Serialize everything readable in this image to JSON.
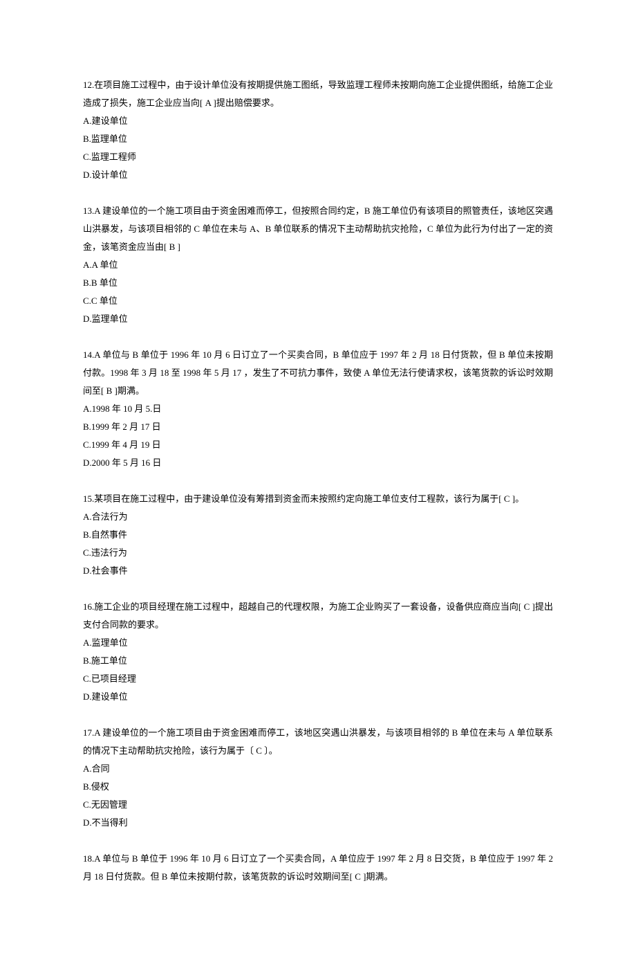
{
  "questions": [
    {
      "number": "12",
      "text": "12.在项目施工过程中，由于设计单位没有按期提供施工图纸，导致监理工程师未按期向施工企业提供图纸，给施工企业造成了损失，施工企业应当向[ A ]提出赔偿要求。",
      "options": [
        "A.建设单位",
        "B.监理单位",
        "C.监理工程师",
        "D.设计单位"
      ]
    },
    {
      "number": "13",
      "text": "13.A 建设单位的一个施工项目由于资金困难而停工，但按照合同约定，B 施工单位仍有该项目的照管责任，该地区突遇山洪暴发，与该项目相邻的 C 单位在未与 A、B 单位联系的情况下主动帮助抗灾抢险，C 单位为此行为付出了一定的资金，该笔资金应当由[ B ]",
      "options": [
        "A.A 单位",
        "B.B 单位",
        "C.C 单位",
        "D.监理单位"
      ]
    },
    {
      "number": "14",
      "text": "14.A 单位与 B 单位于 1996 年 10 月 6 日订立了一个买卖合同，B 单位应于 1997 年 2 月 18 日付货款，但 B 单位未按期付款。1998 年 3 月 18 至 1998 年 5 月 17 ，发生了不可抗力事件，致使 A 单位无法行使请求权，该笔货款的诉讼时效期间至[ B ]期满。",
      "options": [
        "A.1998 年 10 月 5.日",
        "B.1999 年 2 月 17 日",
        "C.1999 年 4 月 19 日",
        "D.2000 年 5 月 16 日"
      ]
    },
    {
      "number": "15",
      "text": "15.某项目在施工过程中，由于建设单位没有筹措到资金而未按照约定向施工单位支付工程款，该行为属于[ C ]。",
      "options": [
        "A.合法行为",
        "B.自然事件",
        "C.违法行为",
        "D.社会事件"
      ]
    },
    {
      "number": "16",
      "text": "16.施工企业的项目经理在施工过程中，超越自己的代理权限，为施工企业购买了一套设备，设备供应商应当向[ C ]提出支付合同款的要求。",
      "options": [
        "A.监理单位",
        "B.施工单位",
        "C.已项目经理",
        "D.建设单位"
      ]
    },
    {
      "number": "17",
      "text": "17.A 建设单位的一个施工项目由于资金困难而停工，该地区突遇山洪暴发，与该项目相邻的 B 单位在未与 A 单位联系的情况下主动帮助抗灾抢险，该行为属于〔 C 〕。",
      "options": [
        "A.合同",
        "B.侵权",
        "C.无因管理",
        "D.不当得利"
      ]
    },
    {
      "number": "18",
      "text": "18.A 单位与 B 单位于 1996 年 10 月 6 日订立了一个买卖合同，A 单位应于 1997 年 2 月 8 日交货，B 单位应于 1997 年 2 月 18 日付货款。但 B 单位未按期付款，该笔货款的诉讼时效期间至[ C ]期满。",
      "options": []
    }
  ]
}
